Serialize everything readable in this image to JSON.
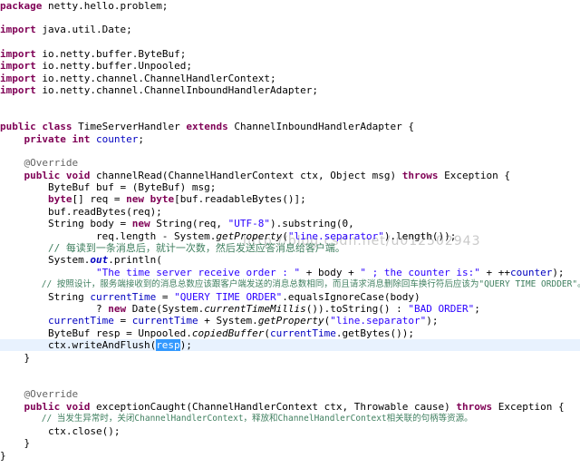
{
  "watermark": "http://blog.csdn.net/u012502943",
  "code": {
    "l1": [
      {
        "t": "package",
        "c": "kw"
      },
      {
        "t": " netty.hello.problem;"
      }
    ],
    "l2": [
      {
        "t": "import",
        "c": "kw"
      },
      {
        "t": " java.util.Date;"
      }
    ],
    "l3": [
      {
        "t": "import",
        "c": "kw"
      },
      {
        "t": " io.netty.buffer.ByteBuf;"
      }
    ],
    "l4": [
      {
        "t": "import",
        "c": "kw"
      },
      {
        "t": " io.netty.buffer.Unpooled;"
      }
    ],
    "l5": [
      {
        "t": "import",
        "c": "kw"
      },
      {
        "t": " io.netty.channel.ChannelHandlerContext;"
      }
    ],
    "l6": [
      {
        "t": "import",
        "c": "kw"
      },
      {
        "t": " io.netty.channel.ChannelInboundHandlerAdapter;"
      }
    ],
    "l7": [
      {
        "t": "public",
        "c": "kw"
      },
      {
        "t": " "
      },
      {
        "t": "class",
        "c": "kw"
      },
      {
        "t": " TimeServerHandler "
      },
      {
        "t": "extends",
        "c": "kw"
      },
      {
        "t": " ChannelInboundHandlerAdapter {"
      }
    ],
    "l8": [
      {
        "t": "    "
      },
      {
        "t": "private",
        "c": "kw"
      },
      {
        "t": " "
      },
      {
        "t": "int",
        "c": "kw"
      },
      {
        "t": " "
      },
      {
        "t": "counter",
        "c": "field"
      },
      {
        "t": ";"
      }
    ],
    "l9": [
      {
        "t": "    "
      },
      {
        "t": "@Override",
        "c": "ann"
      }
    ],
    "l10": [
      {
        "t": "    "
      },
      {
        "t": "public",
        "c": "kw"
      },
      {
        "t": " "
      },
      {
        "t": "void",
        "c": "kw"
      },
      {
        "t": " channelRead(ChannelHandlerContext ctx, Object msg) "
      },
      {
        "t": "throws",
        "c": "kw"
      },
      {
        "t": " Exception {"
      }
    ],
    "l11": [
      {
        "t": "        ByteBuf buf = (ByteBuf) msg;"
      }
    ],
    "l12": [
      {
        "t": "        "
      },
      {
        "t": "byte",
        "c": "kw"
      },
      {
        "t": "[] req = "
      },
      {
        "t": "new",
        "c": "kw"
      },
      {
        "t": " "
      },
      {
        "t": "byte",
        "c": "kw"
      },
      {
        "t": "[buf.readableBytes()];"
      }
    ],
    "l13": [
      {
        "t": "        buf.readBytes(req);"
      }
    ],
    "l14": [
      {
        "t": "        String body = "
      },
      {
        "t": "new",
        "c": "kw"
      },
      {
        "t": " String(req, "
      },
      {
        "t": "\"UTF-8\"",
        "c": "str"
      },
      {
        "t": ").substring(0,"
      }
    ],
    "l15": [
      {
        "t": "                req.length - System."
      },
      {
        "t": "getProperty",
        "c": "smeth"
      },
      {
        "t": "("
      },
      {
        "t": "\"line.separator\"",
        "c": "str"
      },
      {
        "t": ").length());"
      }
    ],
    "l16": [
      {
        "t": "        "
      },
      {
        "t": "// 每读到一条消息后，就计一次数，然后发送应答消息给客户端。",
        "c": "cmt"
      }
    ],
    "l17": [
      {
        "t": "        System."
      },
      {
        "t": "out",
        "c": "sfield"
      },
      {
        "t": ".println("
      }
    ],
    "l18": [
      {
        "t": "                "
      },
      {
        "t": "\"The time server receive order : \"",
        "c": "str"
      },
      {
        "t": " + body + "
      },
      {
        "t": "\" ; the counter is:\"",
        "c": "str"
      },
      {
        "t": " + ++"
      },
      {
        "t": "counter",
        "c": "field"
      },
      {
        "t": ");"
      }
    ],
    "l19": [
      {
        "t": "        "
      },
      {
        "t": "// 按照设计，服务端接收到的消息总数应该跟客户端发送的消息总数相同，而且请求消息删除回车换行符后应该为\"QUERY TIME ORDDER\"。",
        "c": "cmt"
      }
    ],
    "l20": [
      {
        "t": "        String "
      },
      {
        "t": "currentTime",
        "c": "field"
      },
      {
        "t": " = "
      },
      {
        "t": "\"QUERY TIME ORDER\"",
        "c": "str"
      },
      {
        "t": ".equalsIgnoreCase(body)"
      }
    ],
    "l21": [
      {
        "t": "                ? "
      },
      {
        "t": "new",
        "c": "kw"
      },
      {
        "t": " Date(System."
      },
      {
        "t": "currentTimeMillis",
        "c": "smeth"
      },
      {
        "t": "()).toString() : "
      },
      {
        "t": "\"BAD ORDER\"",
        "c": "str"
      },
      {
        "t": ";"
      }
    ],
    "l22": [
      {
        "t": "        "
      },
      {
        "t": "currentTime",
        "c": "field"
      },
      {
        "t": " = "
      },
      {
        "t": "currentTime",
        "c": "field"
      },
      {
        "t": " + System."
      },
      {
        "t": "getProperty",
        "c": "smeth"
      },
      {
        "t": "("
      },
      {
        "t": "\"line.separator\"",
        "c": "str"
      },
      {
        "t": ");"
      }
    ],
    "l23": [
      {
        "t": "        ByteBuf resp = Unpooled."
      },
      {
        "t": "copiedBuffer",
        "c": "smeth"
      },
      {
        "t": "("
      },
      {
        "t": "currentTime",
        "c": "field"
      },
      {
        "t": ".getBytes());"
      }
    ],
    "l24": [
      {
        "t": "        ctx.writeAndFlush("
      },
      {
        "t": "resp",
        "c": "sel"
      },
      {
        "t": ");"
      }
    ],
    "l25": [
      {
        "t": "    }"
      }
    ],
    "l26": [
      {
        "t": "    "
      },
      {
        "t": "@Override",
        "c": "ann"
      }
    ],
    "l27": [
      {
        "t": "    "
      },
      {
        "t": "public",
        "c": "kw"
      },
      {
        "t": " "
      },
      {
        "t": "void",
        "c": "kw"
      },
      {
        "t": " exceptionCaught(ChannelHandlerContext ctx, Throwable cause) "
      },
      {
        "t": "throws",
        "c": "kw"
      },
      {
        "t": " Exception {"
      }
    ],
    "l28": [
      {
        "t": "        "
      },
      {
        "t": "// 当发生异常时，关闭ChannelHandlerContext，释放和ChannelHandlerContext相关联的句柄等资源。",
        "c": "cmt"
      }
    ],
    "l29": [
      {
        "t": "        ctx.close();"
      }
    ],
    "l30": [
      {
        "t": "    }"
      }
    ],
    "l31": [
      {
        "t": "}"
      }
    ]
  }
}
